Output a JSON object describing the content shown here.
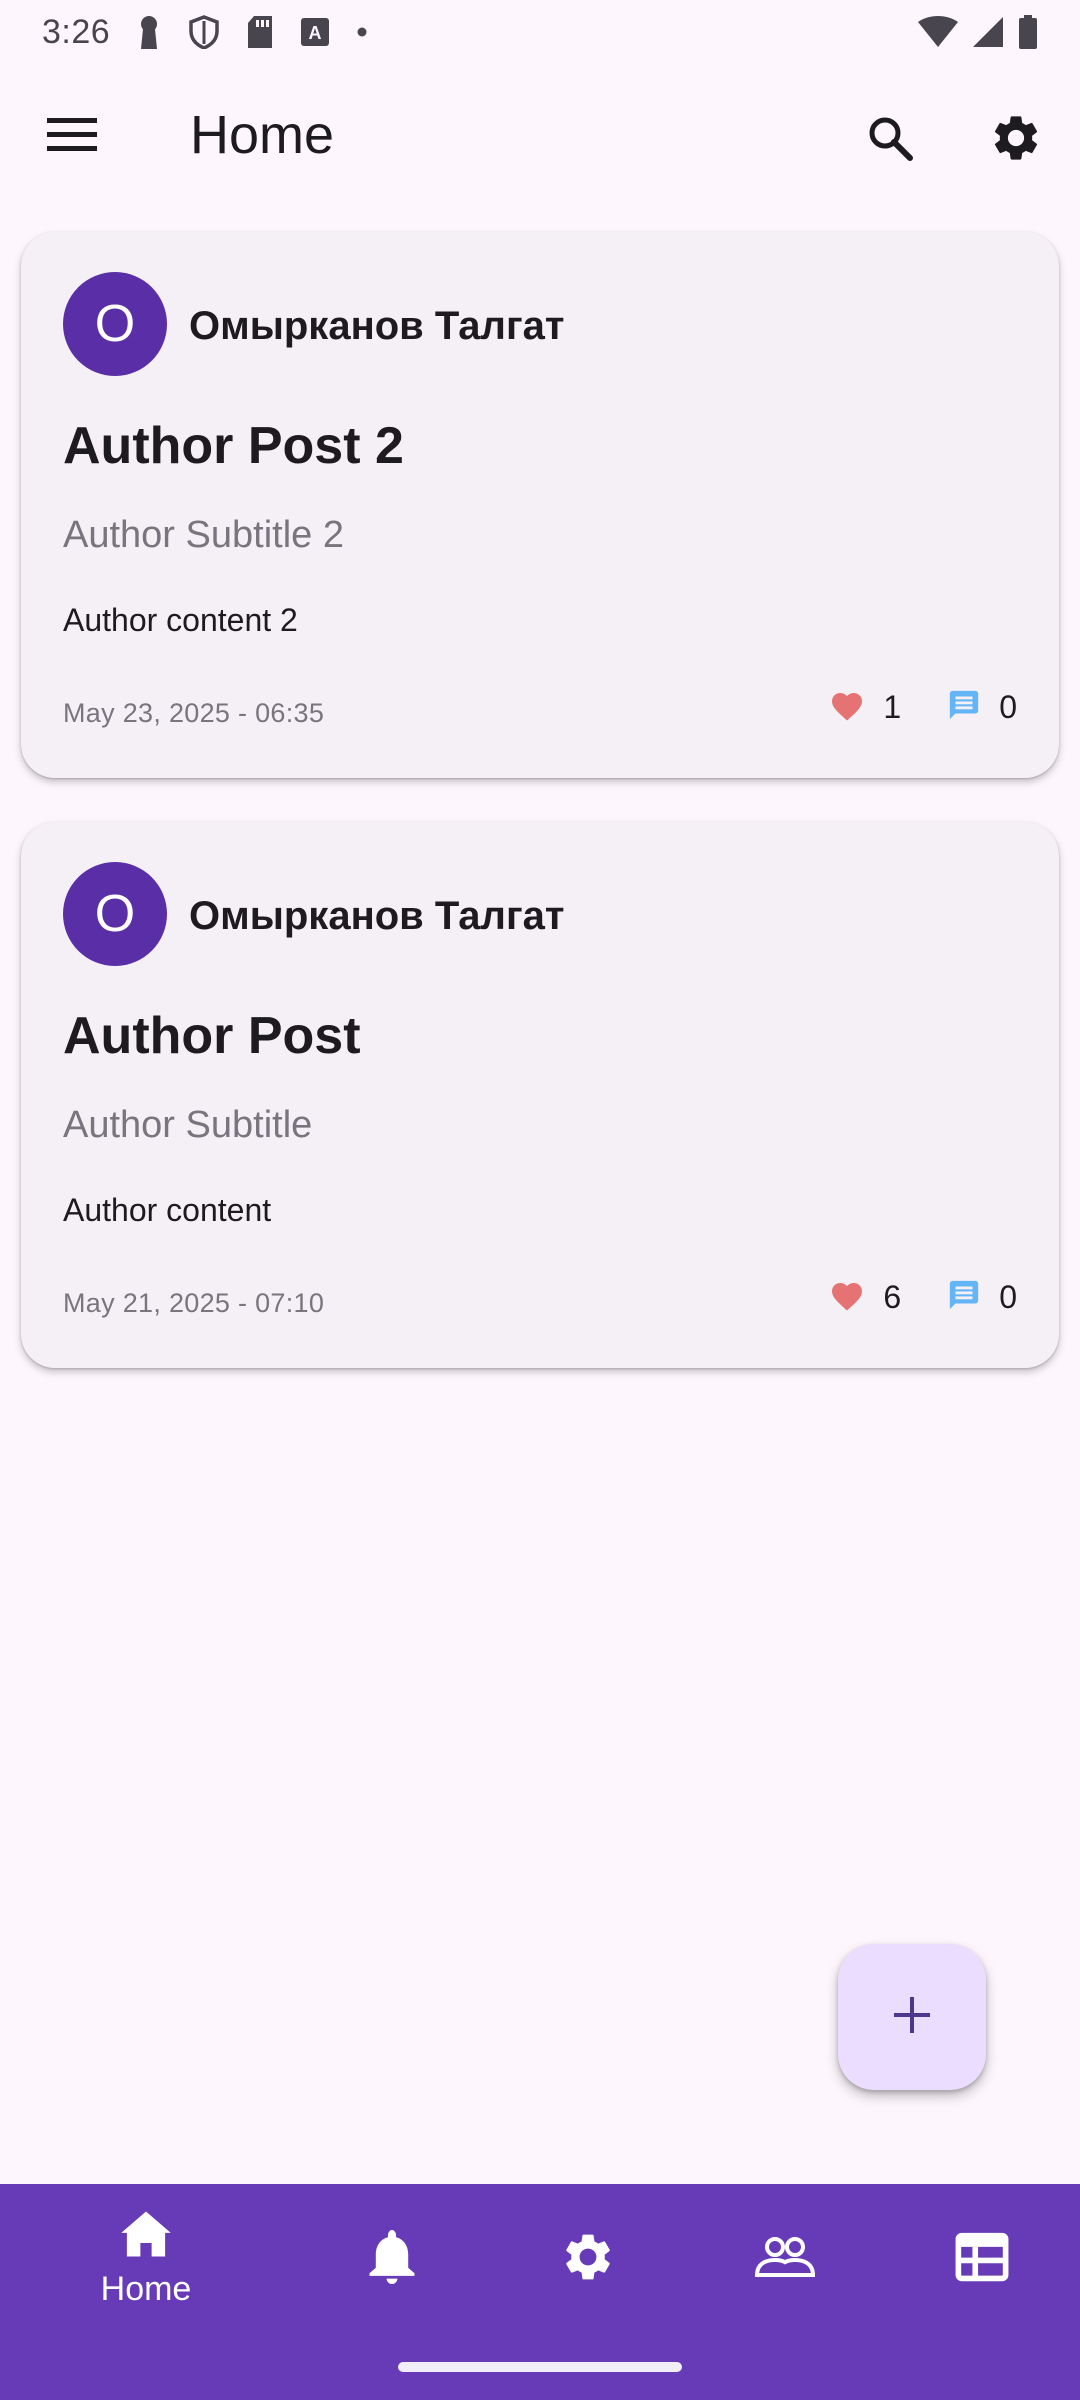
{
  "status_bar": {
    "time": "3:26"
  },
  "app_bar": {
    "title": "Home",
    "menu_icon": "menu-icon",
    "search_icon": "search-icon",
    "settings_icon": "settings-icon"
  },
  "posts": [
    {
      "avatar_letter": "O",
      "author": "Омырканов Талгат",
      "title": "Author Post 2",
      "subtitle": "Author Subtitle 2",
      "content": "Author content 2",
      "date": "May 23, 2025 - 06:35",
      "likes": "1",
      "comments": "0"
    },
    {
      "avatar_letter": "O",
      "author": "Омырканов Талгат",
      "title": "Author Post",
      "subtitle": "Author Subtitle",
      "content": "Author content",
      "date": "May 21, 2025 - 07:10",
      "likes": "6",
      "comments": "0"
    }
  ],
  "fab": {
    "icon": "add-icon"
  },
  "bottom_nav": {
    "items": [
      {
        "icon": "home-icon",
        "label": "Home",
        "selected": true
      },
      {
        "icon": "notifications-icon",
        "label": "",
        "selected": false
      },
      {
        "icon": "settings-icon",
        "label": "",
        "selected": false
      },
      {
        "icon": "people-icon",
        "label": "",
        "selected": false
      },
      {
        "icon": "table-icon",
        "label": "",
        "selected": false
      }
    ]
  },
  "colors": {
    "background": "#fdf7fd",
    "card": "#f5eff6",
    "avatar": "#5a2ea6",
    "like": "#e57373",
    "comment": "#64b5f6",
    "fab": "#eaddff",
    "nav": "#673ab7"
  }
}
